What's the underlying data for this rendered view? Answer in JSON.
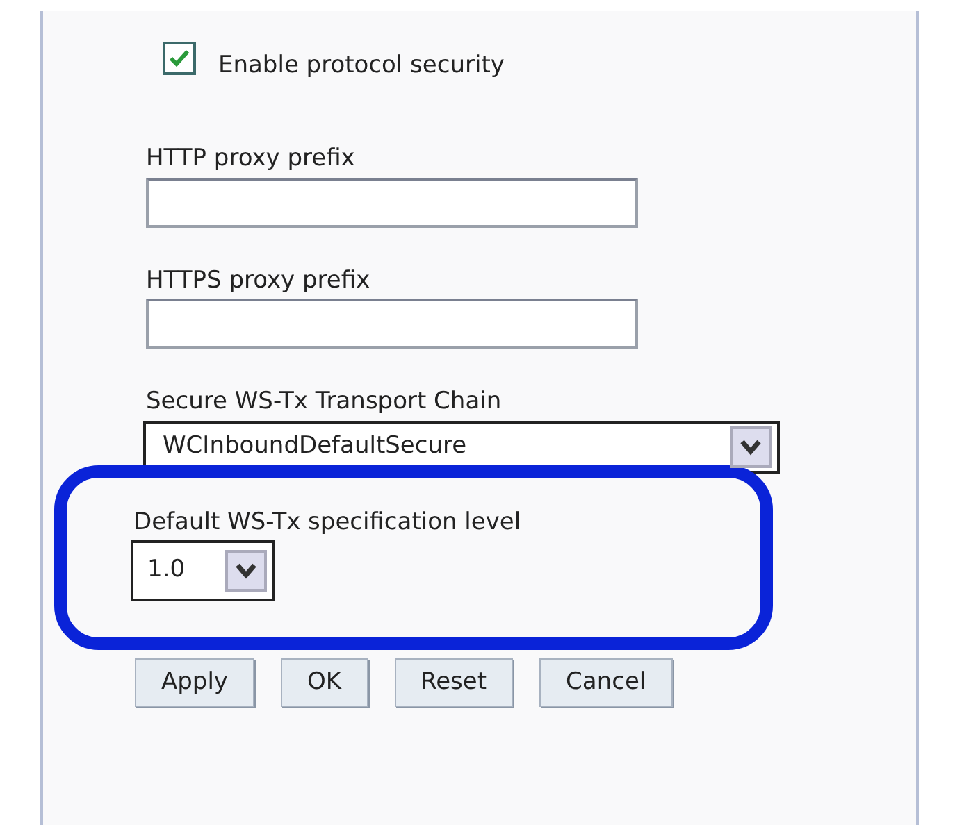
{
  "checkbox": {
    "label": "Enable protocol security",
    "checked": true
  },
  "fields": [
    {
      "label": "HTTP proxy prefix"
    },
    {
      "label": "HTTPS proxy prefix"
    }
  ],
  "transport_chain": {
    "label": "Secure WS-Tx Transport Chain",
    "value": "WCInboundDefaultSecure"
  },
  "spec_level": {
    "label": "Default WS-Tx specification level",
    "value": "1.0",
    "highlighted": true
  },
  "buttons": [
    "Apply",
    "OK",
    "Reset",
    "Cancel"
  ]
}
